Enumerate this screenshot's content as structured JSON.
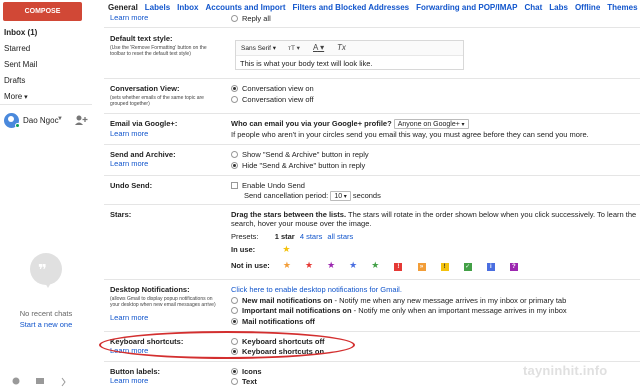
{
  "sidebar": {
    "compose": "COMPOSE",
    "nav": [
      "Inbox (1)",
      "Starred",
      "Sent Mail",
      "Drafts",
      "More"
    ],
    "user_name": "Dao Ngoc",
    "no_chats": "No recent chats",
    "start_new": "Start a new one"
  },
  "tabs": [
    "General",
    "Labels",
    "Inbox",
    "Accounts and Import",
    "Filters and Blocked Addresses",
    "Forwarding and POP/IMAP",
    "Chat",
    "Labs",
    "Offline",
    "Themes"
  ],
  "settings": {
    "top_learn": "Learn more",
    "top_reply_all": "Reply all",
    "default_text": {
      "label": "Default text style:",
      "sub": "(Use the 'Remove Formatting' button on the toolbar to reset the default text style)",
      "font": "Sans Serif",
      "size_icon": "тT",
      "color_icon": "A",
      "clear_icon": "Tx",
      "sample": "This is what your body text will look like."
    },
    "conversation": {
      "label": "Conversation View:",
      "sub": "(sets whether emails of the same topic are grouped together)",
      "on": "Conversation view on",
      "off": "Conversation view off"
    },
    "email_gplus": {
      "label": "Email via Google+:",
      "learn": "Learn more",
      "question": "Who can email you via your Google+ profile?",
      "select": "Anyone on Google+",
      "note": "If people who aren't in your circles send you email this way, you must agree before they can send you more."
    },
    "send_archive": {
      "label": "Send and Archive:",
      "learn": "Learn more",
      "show": "Show \"Send & Archive\" button in reply",
      "hide": "Hide \"Send & Archive\" button in reply"
    },
    "undo_send": {
      "label": "Undo Send:",
      "enable": "Enable Undo Send",
      "period_label": "Send cancellation period:",
      "period_value": "10",
      "seconds": "seconds"
    },
    "stars": {
      "label": "Stars:",
      "desc": "Drag the stars between the lists.",
      "desc2": " The stars will rotate in the order shown below when you click successively. To learn the",
      "desc3": "search, hover your mouse over the image.",
      "presets": "Presets:",
      "p1": "1 star",
      "p2": "4 stars",
      "p3": "all stars",
      "in_use": "In use:",
      "not_in_use": "Not in use:"
    },
    "desktop": {
      "label": "Desktop Notifications:",
      "sub": "(allows Gmail to display popup notifications on your desktop when new email messages arrive)",
      "learn": "Learn more",
      "enable_link": "Click here to enable desktop notifications for Gmail.",
      "new_mail": "New mail notifications on",
      "new_mail_desc": " - Notify me when any new message arrives in my inbox or primary tab",
      "important": "Important mail notifications on",
      "important_desc": " - Notify me only when an important message arrives in my inbox",
      "off": "Mail notifications off"
    },
    "keyboard": {
      "label": "Keyboard shortcuts:",
      "learn": "Learn more",
      "off": "Keyboard shortcuts off",
      "on": "Keyboard shortcuts on"
    },
    "button_labels": {
      "label": "Button labels:",
      "learn": "Learn more",
      "icons": "Icons",
      "text": "Text"
    }
  },
  "watermark": "tayninhit.info",
  "colors": {
    "compose": "#d14836",
    "link": "#1155cc",
    "highlight_ring": "#d32f2f"
  }
}
